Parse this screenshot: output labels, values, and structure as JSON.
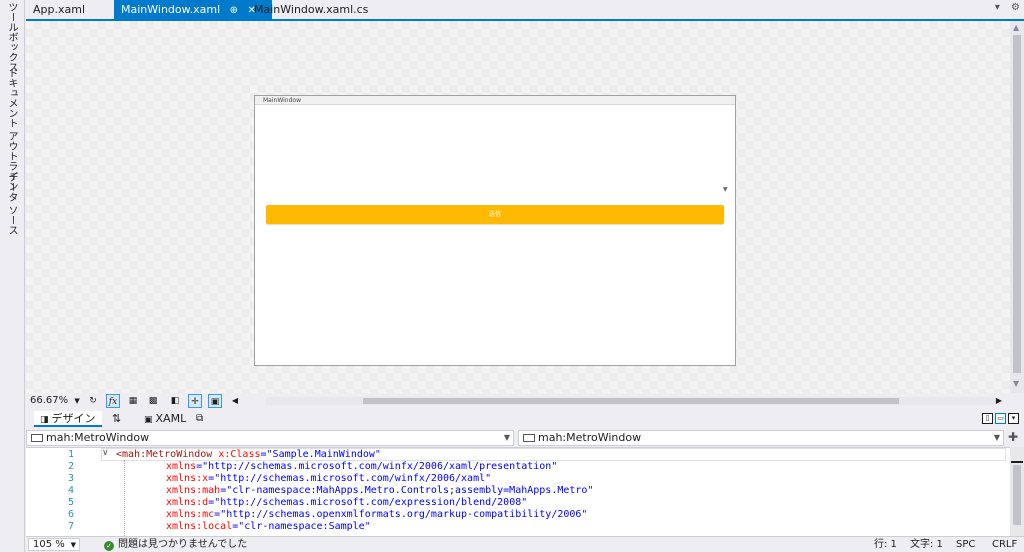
{
  "left_rail": {
    "items": [
      "ツールボックス",
      "ドキュメント アウトライン",
      "データ ソース"
    ]
  },
  "tabs": [
    {
      "label": "App.xaml",
      "active": false
    },
    {
      "label": "MainWindow.xaml",
      "active": true,
      "pin": "⊕",
      "close": "✕"
    },
    {
      "label": "MainWindow.xaml.cs",
      "active": false
    }
  ],
  "design_window": {
    "title": "MainWindow",
    "button_label": "送信"
  },
  "zoombar": {
    "zoom_value": "66.67%"
  },
  "viewbar": {
    "design_label": "デザイン",
    "swap_label": "⇅",
    "xaml_label": "XAML"
  },
  "combos": {
    "left": "mah:MetroWindow",
    "right": "mah:MetroWindow"
  },
  "editor": {
    "line_numbers": [
      "1",
      "2",
      "3",
      "4",
      "5",
      "6",
      "7"
    ],
    "lines": [
      {
        "tag": "<mah:MetroWindow",
        "attr": " x:Class",
        "eq": "=",
        "val": "\"Sample.MainWindow\""
      },
      {
        "attr": "xmlns",
        "eq": "=",
        "val": "\"http://schemas.microsoft.com/winfx/2006/xaml/presentation\""
      },
      {
        "attr": "xmlns:x",
        "eq": "=",
        "val": "\"http://schemas.microsoft.com/winfx/2006/xaml\""
      },
      {
        "attr": "xmlns:mah",
        "eq": "=",
        "val": "\"clr-namespace:MahApps.Metro.Controls;assembly=MahApps.Metro\""
      },
      {
        "attr": "xmlns:d",
        "eq": "=",
        "val": "\"http://schemas.microsoft.com/expression/blend/2008\""
      },
      {
        "attr": "xmlns:mc",
        "eq": "=",
        "val": "\"http://schemas.openxmlformats.org/markup-compatibility/2006\""
      },
      {
        "attr": "xmlns:local",
        "eq": "=",
        "val": "\"clr-namespace:Sample\""
      }
    ]
  },
  "statusbar": {
    "zoom": "105 %",
    "issues": "問題は見つかりませんでした",
    "line": "行: 1",
    "char": "文字: 1",
    "spc": "SPC",
    "crlf": "CRLF"
  },
  "colors": {
    "accent": "#007acc",
    "button": "#ffb900"
  }
}
